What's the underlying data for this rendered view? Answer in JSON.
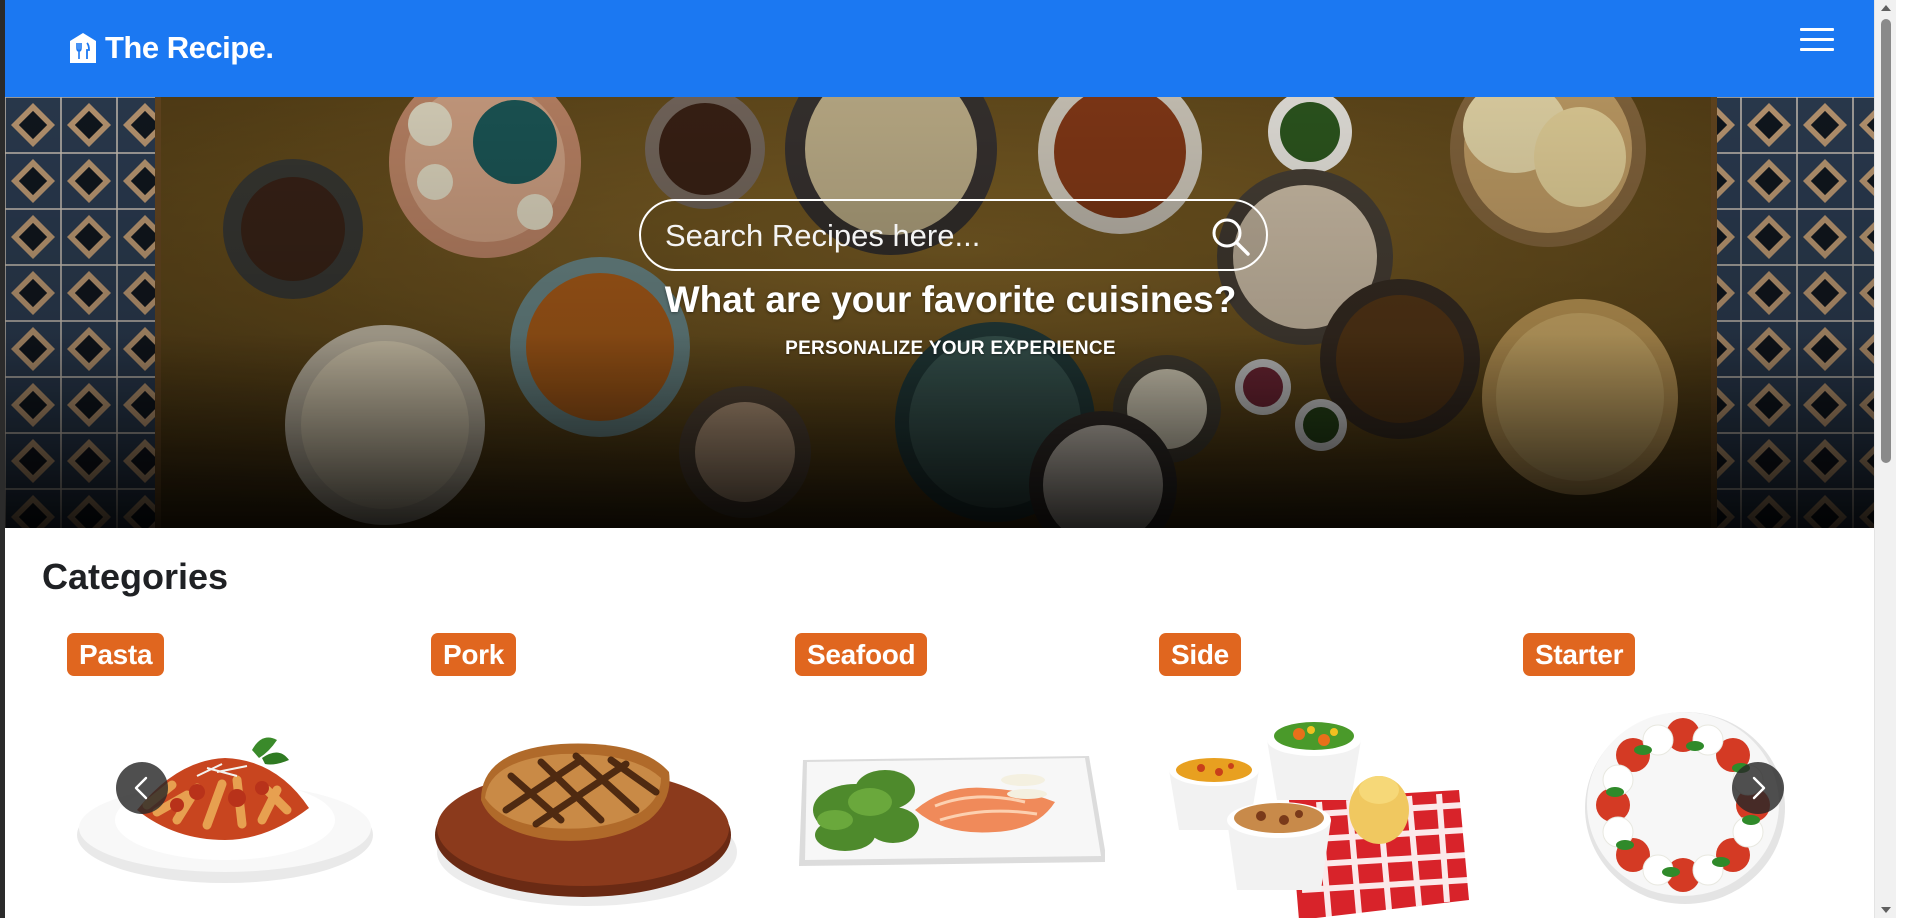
{
  "navbar": {
    "brand": "The Recipe.",
    "logo_icon": "chef-house-icon",
    "menu_icon": "hamburger-menu-icon",
    "background": "#1b78f2"
  },
  "hero": {
    "search_placeholder": "Search Recipes here...",
    "search_icon": "search-icon",
    "title": "What are your favorite cuisines?",
    "subtitle": "PERSONALIZE YOUR EXPERIENCE"
  },
  "categories": {
    "title": "Categories",
    "badge_color": "#e0661f",
    "items": [
      {
        "label": "Pasta",
        "image": "pasta-plate-image"
      },
      {
        "label": "Pork",
        "image": "pork-chop-image"
      },
      {
        "label": "Seafood",
        "image": "salmon-plate-image"
      },
      {
        "label": "Side",
        "image": "side-dishes-image"
      },
      {
        "label": "Starter",
        "image": "caprese-salad-image"
      }
    ],
    "prev_icon": "chevron-left-icon",
    "next_icon": "chevron-right-icon"
  }
}
